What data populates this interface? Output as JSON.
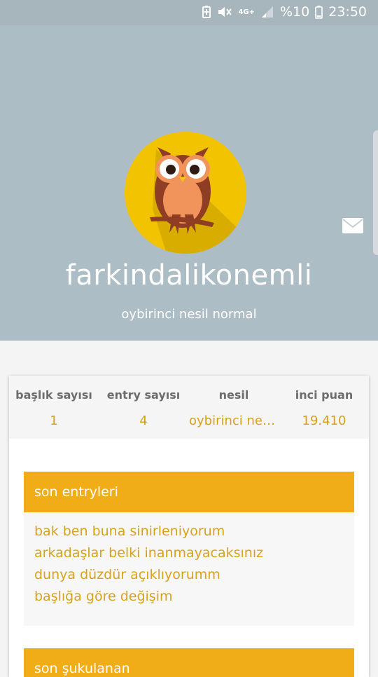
{
  "status_bar": {
    "battery_percent": "%10",
    "time": "23:50",
    "network": "4G+",
    "icons": [
      "battery-saver-icon",
      "mute-icon",
      "network-4g-icon",
      "signal-icon",
      "battery-icon"
    ]
  },
  "profile": {
    "username": "farkindalikonemli",
    "subtitle": "oybirinci nesil normal",
    "avatar_icon": "owl-avatar-icon",
    "message_icon": "mail-icon"
  },
  "stats": [
    {
      "label": "başlık sayısı",
      "value": "1"
    },
    {
      "label": "entry sayısı",
      "value": "4"
    },
    {
      "label": "nesil",
      "value": "oybirinci nesil normal"
    },
    {
      "label": "inci puan",
      "value": "19.410"
    }
  ],
  "recent_entries": {
    "title": "son entryleri",
    "items": [
      "bak ben buna sinirleniyorum",
      "arkadaşlar belki inanmayacaksınız",
      "dunya düzdür açıklıyorumm",
      "başlığa göre değişim"
    ]
  },
  "next_section": {
    "title": "son şukulanan"
  },
  "colors": {
    "header_bg": "#adbdc5",
    "accent": "#f1ad18",
    "link": "#d7a21c",
    "avatar_bg": "#f2c300"
  }
}
